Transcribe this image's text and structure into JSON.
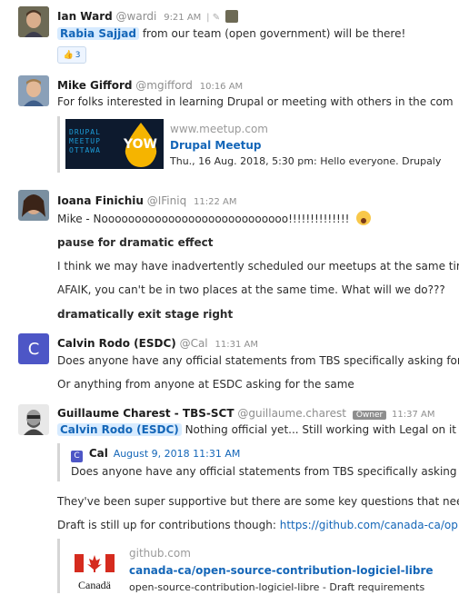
{
  "messages": [
    {
      "author": "Ian Ward",
      "handle": "@wardi",
      "time": "9:21 AM",
      "mention": "Rabia Sajjad",
      "text": "from our team (open government) will be there!",
      "reaction_count": "3"
    },
    {
      "author": "Mike Gifford",
      "handle": "@mgifford",
      "time": "10:16 AM",
      "text": "For folks interested in learning Drupal or meeting with others in the com",
      "preview": {
        "logo_lines": [
          "DRUPAL",
          "MEETUP",
          "OTTAWA"
        ],
        "logo_badge": "YOW",
        "site": "www.meetup.com",
        "title": "Drupal Meetup",
        "desc": "Thu., 16 Aug. 2018, 5:30 pm: Hello everyone. Drupaly"
      }
    },
    {
      "author": "Ioana Finichiu",
      "handle": "@IFiniq",
      "time": "11:22 AM",
      "lines": [
        "Mike - Noooooooooooooooooooooooooooo!!!!!!!!!!!!!!",
        "pause for dramatic effect",
        "I think we may have inadvertently scheduled our meetups at the same tir",
        "AFAIK, you can't be in two places at the same time. What will we do???",
        "dramatically exit stage right"
      ]
    },
    {
      "author": "Calvin Rodo (ESDC)",
      "handle": "@Cal",
      "time": "11:31 AM",
      "avatar_letter": "C",
      "lines": [
        "Does anyone have any official statements from TBS specifically asking for",
        "Or anything from anyone at ESDC asking for the same"
      ]
    },
    {
      "author": "Guillaume Charest - TBS-SCT",
      "handle": "@guillaume.charest",
      "badge": "Owner",
      "time": "11:37 AM",
      "mention": "Calvin Rodo (ESDC)",
      "text": "Nothing official yet... Still working with Legal on it",
      "quote": {
        "letter": "C",
        "author": "Cal",
        "date": "August 9, 2018 11:31 AM",
        "text": "Does anyone have any official statements from TBS specifically asking"
      },
      "lines": [
        "They've been super supportive but there are some key questions that nee",
        "Draft is still up for contributions though:"
      ],
      "link": "https://github.com/canada-ca/op",
      "preview": {
        "logo_text": "Canadä",
        "site": "github.com",
        "title": "canada-ca/open-source-contribution-logiciel-libre",
        "desc": "open-source-contribution-logiciel-libre - Draft requirements"
      }
    }
  ],
  "colors": {
    "link": "#1466b8",
    "mention_bg": "#d7ebff",
    "calvin_avatar": "#4d56c6",
    "meetup_bg": "#0d1a2e",
    "yow_yellow": "#f5b400",
    "canada_red": "#d52b1e"
  }
}
